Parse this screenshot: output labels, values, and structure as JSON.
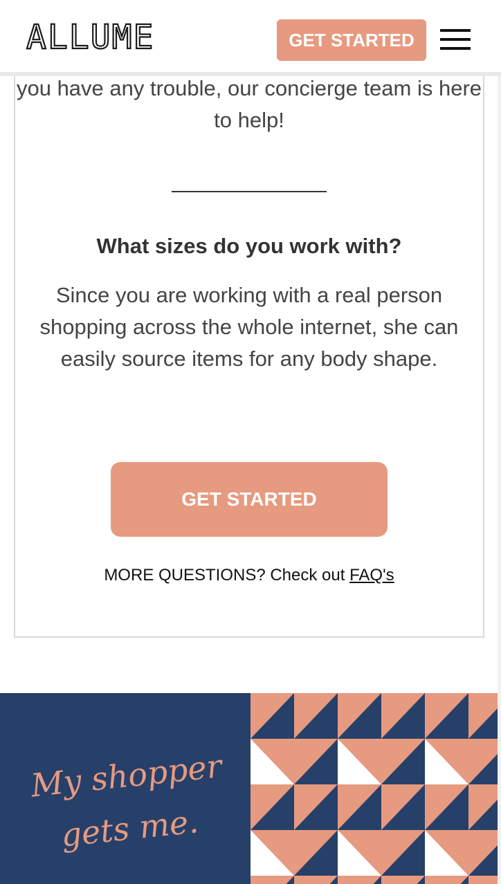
{
  "header": {
    "logo_text": "ALLUME",
    "cta_label": "GET STARTED"
  },
  "content": {
    "intro_text": "you have any trouble, our concierge team is here to help!",
    "faq_question": "What sizes do you work with?",
    "faq_answer": "Since you are working with a real person shopping across the whole internet, she can easily source items for any body shape.",
    "cta_label": "GET STARTED",
    "more_questions_text": "MORE QUESTIONS? Check out ",
    "faq_link_text": "FAQ's"
  },
  "banner": {
    "tagline_line1": "My shopper",
    "tagline_line2": "gets me.",
    "colors": {
      "navy": "#27406a",
      "peach": "#e69a80"
    }
  },
  "colors": {
    "accent": "#e69a80"
  }
}
